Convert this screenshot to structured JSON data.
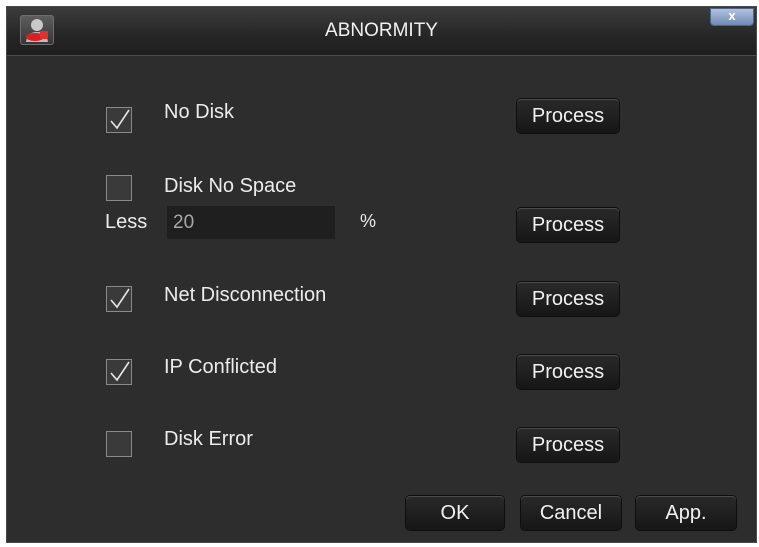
{
  "window": {
    "title": "ABNORMITY",
    "close_label": "x",
    "icon": "user-lock-icon"
  },
  "rows": [
    {
      "label": "No Disk",
      "checked": true,
      "process_label": "Process"
    },
    {
      "label": "Disk No Space",
      "checked": false,
      "process_label": "Process",
      "less_label": "Less",
      "less_value": "20",
      "unit": "%"
    },
    {
      "label": "Net Disconnection",
      "checked": true,
      "process_label": "Process"
    },
    {
      "label": "IP Conflicted",
      "checked": true,
      "process_label": "Process"
    },
    {
      "label": "Disk Error",
      "checked": false,
      "process_label": "Process"
    }
  ],
  "footer": {
    "ok_label": "OK",
    "cancel_label": "Cancel",
    "apply_label": "App."
  },
  "colors": {
    "background": "#2d2d2d",
    "button": "#1c1c1c",
    "text": "#ececec",
    "close_button": "#8ea4c8"
  }
}
